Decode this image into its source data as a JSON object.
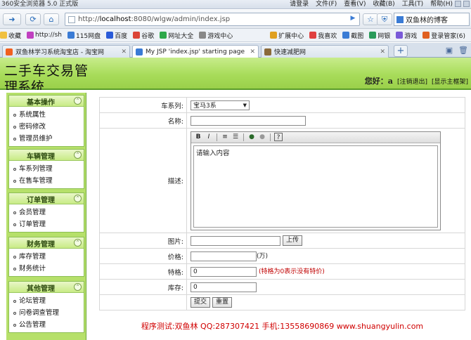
{
  "browser": {
    "title": "360安全浏览器 5.0 正式版",
    "menu": [
      "请登录",
      "文件(F)",
      "查看(V)",
      "收藏(B)",
      "工具(T)",
      "帮助(H)"
    ],
    "address": {
      "scheme": "http://",
      "host": "localhost",
      "path": ":8080/wlgw/admin/index.jsp"
    },
    "search_text": "双鱼林的博客",
    "favorites": [
      {
        "label": "收藏",
        "color": "#f0c040"
      },
      {
        "label": "http://sh",
        "color": "#c040c0"
      },
      {
        "label": "115网盘",
        "color": "#3a7bd5"
      },
      {
        "label": "百度",
        "color": "#2a5bd8"
      },
      {
        "label": "谷歌",
        "color": "#db4437"
      },
      {
        "label": "网址大全",
        "color": "#2ea84a"
      },
      {
        "label": "游戏中心",
        "color": "#888"
      }
    ],
    "favorites_right": [
      {
        "label": "扩展中心",
        "color": "#e0a020"
      },
      {
        "label": "我喜欢",
        "color": "#e04040"
      },
      {
        "label": "截图",
        "color": "#3a7bd5"
      },
      {
        "label": "网银",
        "color": "#2a9a5a"
      },
      {
        "label": "游戏",
        "color": "#7a5ad8"
      },
      {
        "label": "登录管家(6)",
        "color": "#e06020"
      }
    ],
    "tabs": [
      {
        "label": "双鱼林学习系统淘宝店 - 淘宝网",
        "active": false,
        "color": "#f06020"
      },
      {
        "label": "My JSP 'index.jsp' starting page",
        "active": true,
        "color": "#3a7bd5"
      },
      {
        "label": "快速减肥网",
        "active": false,
        "color": "#8a6a3a"
      }
    ]
  },
  "header": {
    "title_line1": "二手车交易管",
    "title_line2": "理系统",
    "greeting": "您好：",
    "username": "a",
    "logout": "[注销退出]",
    "home": "[显示主框架]"
  },
  "sidebar": {
    "sections": [
      {
        "title": "基本操作",
        "items": [
          "系统属性",
          "密码修改",
          "管理员维护"
        ]
      },
      {
        "title": "车辆管理",
        "items": [
          "车系列管理",
          "在售车管理"
        ]
      },
      {
        "title": "订单管理",
        "items": [
          "会员管理",
          "订单管理"
        ]
      },
      {
        "title": "财务管理",
        "items": [
          "库存管理",
          "财务统计"
        ]
      },
      {
        "title": "其他管理",
        "items": [
          "论坛管理",
          "问卷调查管理",
          "公告管理"
        ]
      }
    ]
  },
  "form": {
    "series_label": "车系列:",
    "series_value": "宝马3系",
    "name_label": "名称:",
    "name_value": "",
    "desc_label": "描述:",
    "desc_placeholder": "请输入内容",
    "image_label": "图片:",
    "upload_button": "上传",
    "price_label": "价格:",
    "price_unit": "(万)",
    "special_label": "特格:",
    "special_value": "0",
    "special_hint": "(特格为0表示没有特价)",
    "stock_label": "库存:",
    "stock_value": "0",
    "submit_button": "提交",
    "reset_button": "重置"
  },
  "footer": "程序测试:双鱼林 QQ:287307421 手机:13558690869 www.shuangyulin.com"
}
